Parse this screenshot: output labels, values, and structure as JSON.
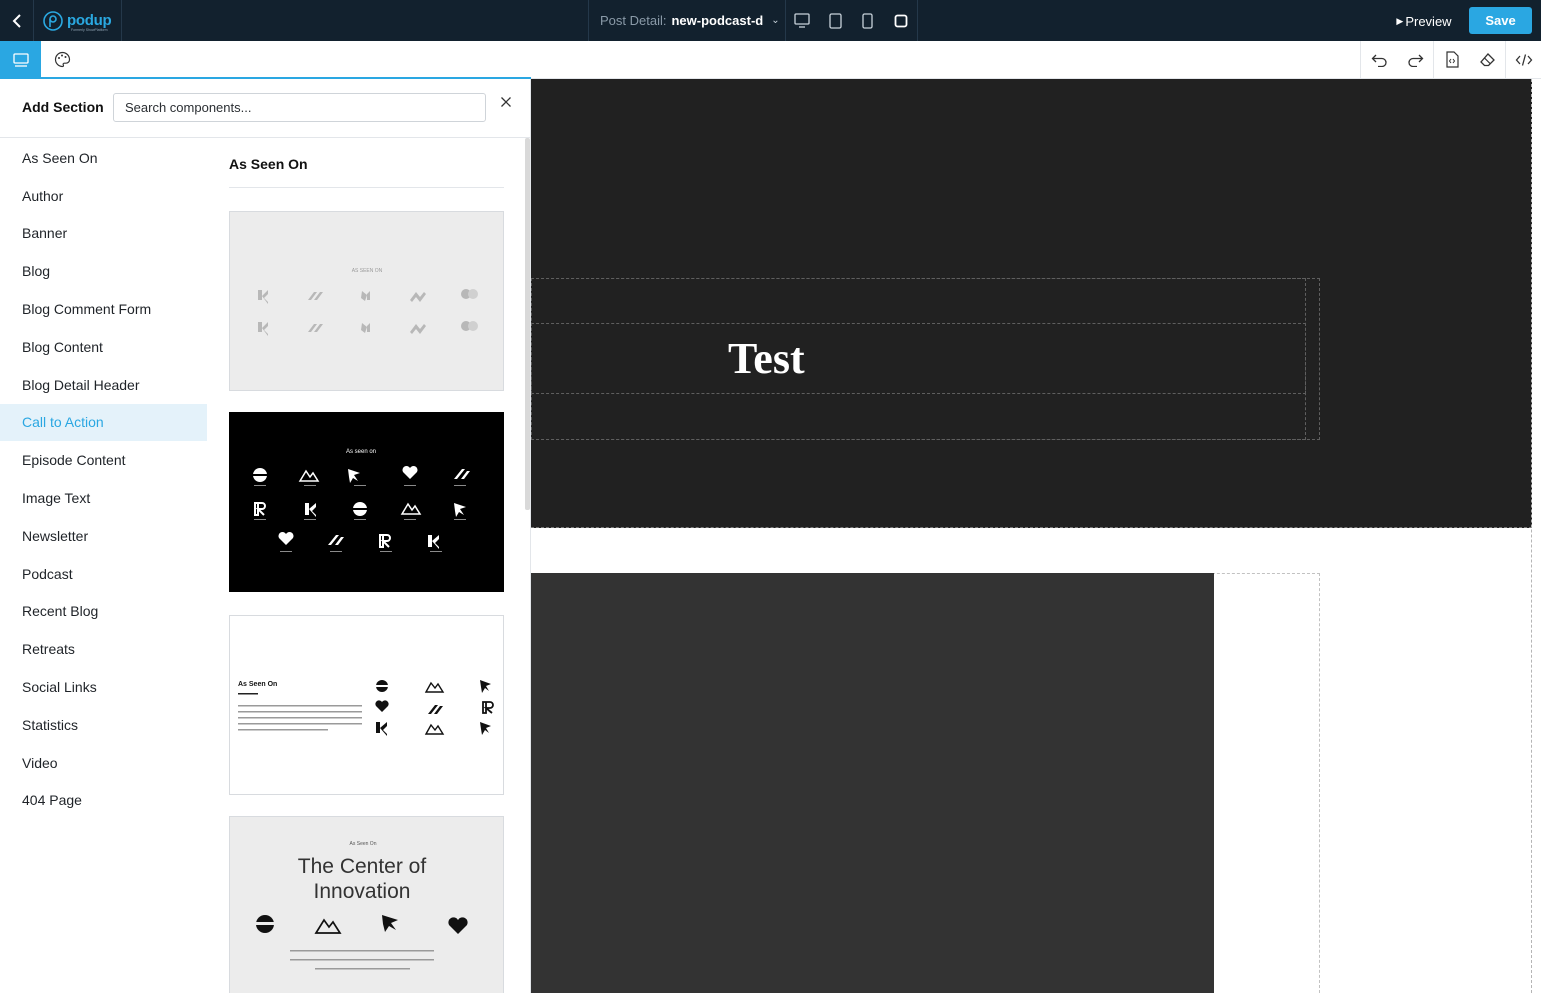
{
  "topbar": {
    "logo_text": "podup",
    "logo_sub": "Formerly ShowPlatform",
    "post_detail_label": "Post Detail:",
    "post_detail_value": "new-podcast-d",
    "preview_label": "Preview",
    "save_label": "Save"
  },
  "panel": {
    "title": "Add Section",
    "search_placeholder": "Search components...",
    "categories": [
      "As Seen On",
      "Author",
      "Banner",
      "Blog",
      "Blog Comment Form",
      "Blog Content",
      "Blog Detail Header",
      "Call to Action",
      "Episode Content",
      "Image Text",
      "Newsletter",
      "Podcast",
      "Recent Blog",
      "Retreats",
      "Social Links",
      "Statistics",
      "Video",
      "404 Page"
    ],
    "active_category": "Call to Action",
    "gallery_title": "As Seen On",
    "thumbs": {
      "t1_caption": "AS SEEN ON",
      "t2_caption": "As seen on",
      "t3_heading": "As Seen On",
      "t4_kicker": "As Seen On",
      "t4_title_line1": "The Center of",
      "t4_title_line2": "Innovation"
    }
  },
  "canvas": {
    "heading": "Test"
  },
  "colors": {
    "topbar_bg": "#12212e",
    "accent": "#2aa7e2",
    "canvas_dark": "#212121",
    "canvas_block": "#333333"
  }
}
